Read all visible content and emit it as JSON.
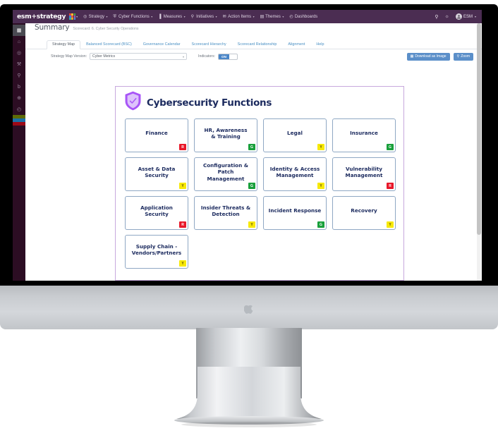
{
  "colors": {
    "nav_purple": "#4b2d52",
    "rail_dark": "#2c0d23",
    "accent_blue": "#5b8fc9",
    "map_border_purple": "#c7a8dd",
    "node_text": "#1b2a5e",
    "status_red": "#e8182a",
    "status_green": "#19a03c",
    "status_yellow": "#f7e908"
  },
  "topnav": {
    "brand": "esm+strategy",
    "app_switcher_icon": "grid-apps-icon",
    "items": [
      {
        "label": "Strategy",
        "icon": "target-icon",
        "caret": "▾"
      },
      {
        "label": "Cyber Functions",
        "icon": "shield-icon",
        "caret": "▾"
      },
      {
        "label": "Measures",
        "icon": "bar-chart-icon",
        "caret": "▾"
      },
      {
        "label": "Initiatives",
        "icon": "lightbulb-icon",
        "caret": "▾"
      },
      {
        "label": "Action Items",
        "icon": "envelope-icon",
        "caret": "▾"
      },
      {
        "label": "Themes",
        "icon": "folder-icon",
        "caret": "▾"
      },
      {
        "label": "Dashboards",
        "icon": "clock-icon",
        "caret": ""
      }
    ],
    "search_icon": "search-icon",
    "notification_icon": "bell-icon",
    "user": {
      "name": "ESM",
      "caret": "▾",
      "avatar_icon": "avatar-icon"
    }
  },
  "rail": {
    "items": [
      {
        "name": "scorecard-grid",
        "icon": "grid-icon",
        "glyph": "▦",
        "active": true
      },
      {
        "name": "home",
        "icon": "home-icon",
        "glyph": "⌂",
        "active": false
      },
      {
        "name": "strategy",
        "icon": "compass-icon",
        "glyph": "◎",
        "active": false
      },
      {
        "name": "tools",
        "icon": "wrench-icon",
        "glyph": "⚒",
        "active": false
      },
      {
        "name": "initiatives",
        "icon": "lightbulb-icon",
        "glyph": "⚲",
        "active": false
      },
      {
        "name": "reports",
        "icon": "document-icon",
        "glyph": "὜b",
        "active": false
      },
      {
        "name": "global",
        "icon": "globe-icon",
        "glyph": "⊕",
        "active": false
      },
      {
        "name": "history",
        "icon": "clock-icon",
        "glyph": "◴",
        "active": false
      }
    ],
    "bars": [
      "#5e6b07",
      "#1a6fa8",
      "#9c0a18"
    ]
  },
  "header": {
    "title": "Summary",
    "subtitle": "Scorecard: 6. Cyber Security Operations"
  },
  "tabs": [
    {
      "label": "Strategy Map",
      "active": true
    },
    {
      "label": "Balanced Scorecard (BSC)",
      "active": false
    },
    {
      "label": "Governance Calendar",
      "active": false
    },
    {
      "label": "Scorecard Hierarchy",
      "active": false
    },
    {
      "label": "Scorecard Relationship",
      "active": false
    },
    {
      "label": "Alignment",
      "active": false
    },
    {
      "label": "Help",
      "active": false
    }
  ],
  "toolbar": {
    "version_label": "Strategy Map Version:",
    "version_value": "Cyber Metrics",
    "version_caret": "▾",
    "indicators_label": "Indicators:",
    "indicators_state": "ON",
    "download_button": "Download as Image",
    "download_icon": "image-icon",
    "zoom_button": "Zoom",
    "zoom_icon": "magnifier-icon"
  },
  "map": {
    "title": "Cybersecurity Functions",
    "title_icon": "shield-check-icon",
    "nodes": [
      {
        "label": "Finance",
        "status": "R",
        "status_name": "red"
      },
      {
        "label": "HR, Awareness\n& Training",
        "status": "G",
        "status_name": "green"
      },
      {
        "label": "Legal",
        "status": "Y",
        "status_name": "yellow"
      },
      {
        "label": "Insurance",
        "status": "G",
        "status_name": "green"
      },
      {
        "label": "Asset & Data\nSecurity",
        "status": "Y",
        "status_name": "yellow"
      },
      {
        "label": "Configuration &\nPatch Management",
        "status": "G",
        "status_name": "green"
      },
      {
        "label": "Identity & Access\nManagement",
        "status": "Y",
        "status_name": "yellow"
      },
      {
        "label": "Vulnerability\nManagement",
        "status": "R",
        "status_name": "red"
      },
      {
        "label": "Application\nSecurity",
        "status": "R",
        "status_name": "red"
      },
      {
        "label": "Insider Threats &\nDetection",
        "status": "Y",
        "status_name": "yellow"
      },
      {
        "label": "Incident Response",
        "status": "G",
        "status_name": "green"
      },
      {
        "label": "Recovery",
        "status": "Y",
        "status_name": "yellow"
      },
      {
        "label": "Supply Chain -\nVendors/Partners",
        "status": "Y",
        "status_name": "yellow"
      }
    ]
  }
}
